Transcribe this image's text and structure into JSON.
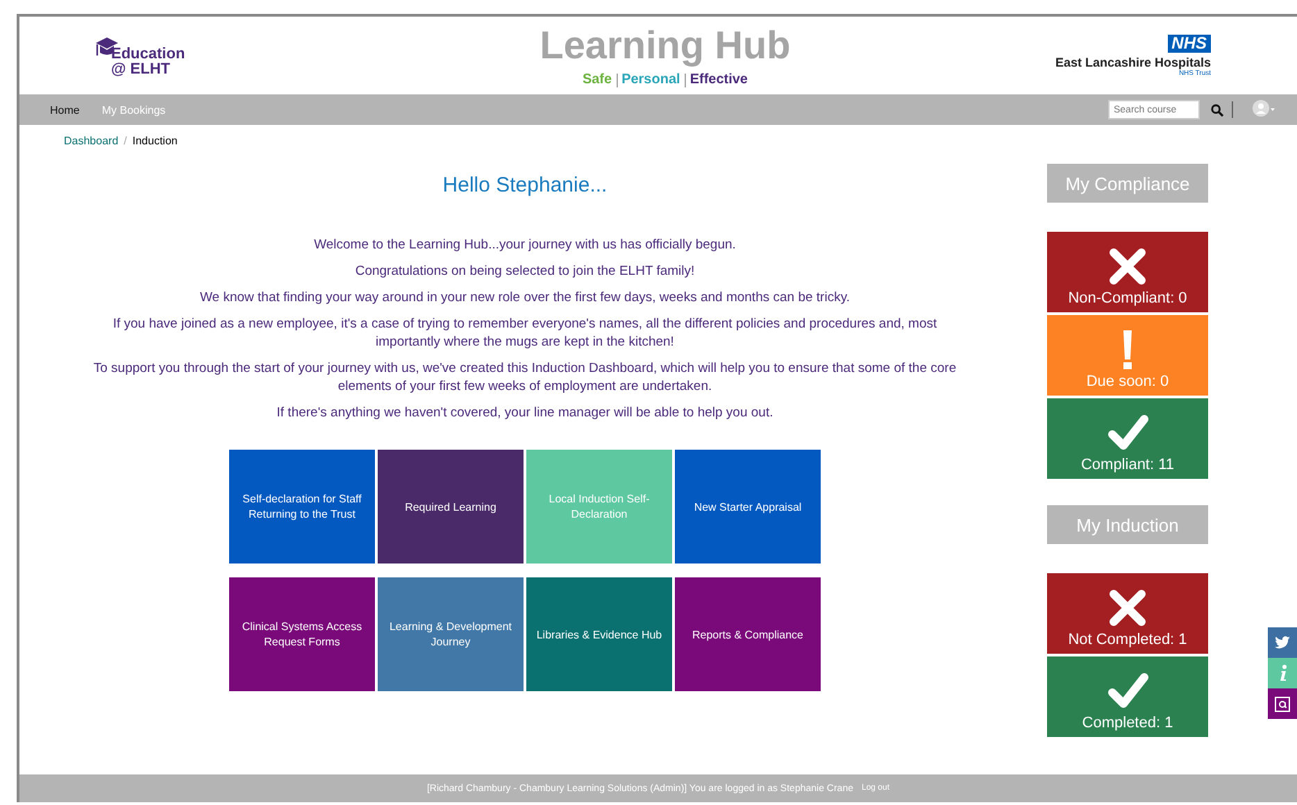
{
  "header": {
    "logo_lines": [
      "Education",
      "@ ELHT"
    ],
    "title": "Learning Hub",
    "tagline": [
      {
        "text": "Safe",
        "color": "#6cb33f"
      },
      {
        "text": "Personal",
        "color": "#2aa6b8"
      },
      {
        "text": "Effective",
        "color": "#4b2a7b"
      }
    ],
    "nhs_badge": "NHS",
    "trust_name": "East Lancashire Hospitals",
    "trust_sub": "NHS Trust"
  },
  "nav": {
    "items": [
      {
        "label": "Home",
        "selected": true
      },
      {
        "label": "My Bookings",
        "selected": false
      }
    ],
    "search": {
      "placeholder": "Search course"
    }
  },
  "breadcrumb": [
    "Dashboard",
    "Induction"
  ],
  "breadcrumb_separator": "/",
  "greeting": "Hello Stephanie...",
  "paragraphs": [
    "Welcome to the Learning Hub...your journey with us has officially begun.",
    "Congratulations on being selected to join the ELHT family!",
    "We know that finding your way around in your new role over the first few days, weeks and months can be tricky.",
    "If you have joined as a new employee, it's a case of trying to remember everyone's names, all the different policies and procedures and, most importantly where the mugs are kept in the kitchen!",
    "To support you through the start of your journey with us, we've created this Induction Dashboard, which will help you to ensure that some of the core elements of your first few weeks of employment are undertaken.",
    "If there's anything we haven't covered, your line manager will be able to help you out."
  ],
  "tiles": [
    {
      "label": "Self-declaration for Staff Returning to the Trust",
      "color": "#0359c0"
    },
    {
      "label": "Required Learning",
      "color": "#4a2a68"
    },
    {
      "label": "Local Induction Self-Declaration",
      "color": "#5ec8a0"
    },
    {
      "label": "New Starter Appraisal",
      "color": "#0359c0"
    },
    {
      "label": "Clinical Systems Access Request Forms",
      "color": "#7a0a7a"
    },
    {
      "label": "Learning & Development Journey",
      "color": "#4178a8"
    },
    {
      "label": "Libraries & Evidence Hub",
      "color": "#0b7070"
    },
    {
      "label": "Reports & Compliance",
      "color": "#7a0a7a"
    }
  ],
  "sections": [
    {
      "title": "My Compliance",
      "statuses": [
        {
          "kind": "cross",
          "label": "Non-Compliant: 0",
          "color": "#a31f22"
        },
        {
          "kind": "exclaim",
          "label": "Due soon: 0",
          "color": "#fd8223"
        },
        {
          "kind": "tick",
          "label": "Compliant: 11",
          "color": "#2b8150"
        }
      ]
    },
    {
      "title": "My Induction",
      "statuses": [
        {
          "kind": "cross",
          "label": "Not Completed: 1",
          "color": "#a31f22"
        },
        {
          "kind": "tick",
          "label": "Completed: 1",
          "color": "#2b8150"
        }
      ]
    }
  ],
  "footer": {
    "text": "[Richard Chambury - Chambury Learning Solutions (Admin)] You are logged in as Stephanie Crane",
    "logout": "Log out"
  }
}
